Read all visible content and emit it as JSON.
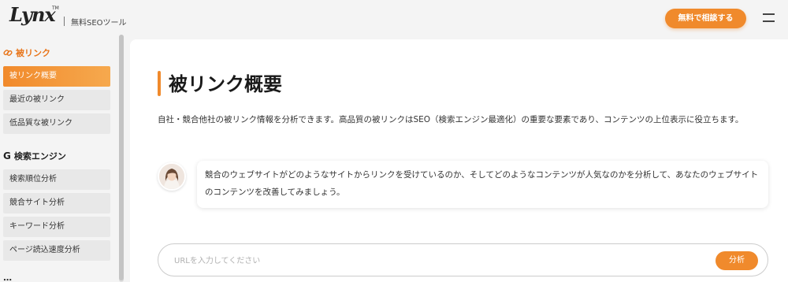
{
  "header": {
    "logo_text": "Lynx",
    "logo_tm": "TM",
    "tagline": "無料SEOツール",
    "cta_label": "無料で相談する"
  },
  "sidebar": {
    "sections": [
      {
        "title": "被リンク",
        "icon": "link-icon",
        "items": [
          {
            "label": "被リンク概要",
            "active": true
          },
          {
            "label": "最近の被リンク",
            "active": false
          },
          {
            "label": "低品質な被リンク",
            "active": false
          }
        ]
      },
      {
        "title": "検索エンジン",
        "icon": "google-g-icon",
        "items": [
          {
            "label": "検索順位分析"
          },
          {
            "label": "競合サイト分析"
          },
          {
            "label": "キーワード分析"
          },
          {
            "label": "ページ読込速度分析"
          }
        ]
      }
    ]
  },
  "main": {
    "title": "被リンク概要",
    "description": "自社・競合他社の被リンク情報を分析できます。高品質の被リンクはSEO（検索エンジン最適化）の重要な要素であり、コンテンツの上位表示に役立ちます。",
    "bubble_text": "競合のウェブサイトがどのようなサイトからリンクを受けているのか、そしてどのようなコンテンツが人気なのかを分析して、あなたのウェブサイトのコンテンツを改善してみましょう。",
    "url_placeholder": "URLを入力してください",
    "analyze_label": "分析"
  },
  "colors": {
    "accent": "#f08a2c",
    "active_gradient_end": "#f6a94e"
  }
}
